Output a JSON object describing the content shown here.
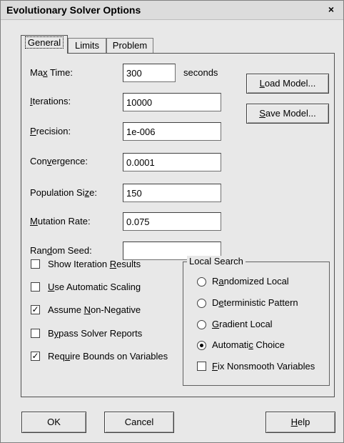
{
  "window": {
    "title": "Evolutionary Solver Options",
    "close_glyph": "×"
  },
  "tabs": [
    {
      "label": "General",
      "active": true
    },
    {
      "label": "Limits",
      "active": false
    },
    {
      "label": "Problem",
      "active": false
    }
  ],
  "fields": {
    "max_time": {
      "label_pre": "Ma",
      "label_u": "x",
      "label_post": " Time:",
      "value": "300",
      "unit": "seconds"
    },
    "iterations": {
      "label_pre": "",
      "label_u": "I",
      "label_post": "terations:",
      "value": "10000"
    },
    "precision": {
      "label_pre": "",
      "label_u": "P",
      "label_post": "recision:",
      "value": "1e-006"
    },
    "convergence": {
      "label_pre": "Con",
      "label_u": "v",
      "label_post": "ergence:",
      "value": "0.0001"
    },
    "population_size": {
      "label_pre": "Population Si",
      "label_u": "z",
      "label_post": "e:",
      "value": "150"
    },
    "mutation_rate": {
      "label_pre": "",
      "label_u": "M",
      "label_post": "utation Rate:",
      "value": "0.075"
    },
    "random_seed": {
      "label_pre": "Ran",
      "label_u": "d",
      "label_post": "om Seed:",
      "value": ""
    }
  },
  "buttons": {
    "load_model": {
      "pre": "",
      "u": "L",
      "post": "oad Model..."
    },
    "save_model": {
      "pre": "",
      "u": "S",
      "post": "ave Model..."
    },
    "ok": "OK",
    "cancel": "Cancel",
    "help": {
      "pre": "",
      "u": "H",
      "post": "elp"
    }
  },
  "checkboxes": [
    {
      "pre": "Show Iteration ",
      "u": "R",
      "post": "esults",
      "checked": false
    },
    {
      "pre": "",
      "u": "U",
      "post": "se Automatic Scaling",
      "checked": false
    },
    {
      "pre": "Assume ",
      "u": "N",
      "post": "on-Negative",
      "checked": true
    },
    {
      "pre": "B",
      "u": "y",
      "post": "pass Solver Reports",
      "checked": false
    },
    {
      "pre": "Req",
      "u": "u",
      "post": "ire Bounds on Variables",
      "checked": true
    }
  ],
  "local_search": {
    "legend": "Local Search",
    "options": [
      {
        "pre": "R",
        "u": "a",
        "post": "ndomized Local",
        "selected": false
      },
      {
        "pre": "D",
        "u": "e",
        "post": "terministic Pattern",
        "selected": false
      },
      {
        "pre": "",
        "u": "G",
        "post": "radient Local",
        "selected": false
      },
      {
        "pre": "Automati",
        "u": "c",
        "post": " Choice",
        "selected": true
      }
    ],
    "fix_nonsmooth": {
      "pre": "",
      "u": "F",
      "post": "ix Nonsmooth Variables",
      "checked": false
    }
  },
  "glyphs": {
    "check_mark": "✓"
  }
}
